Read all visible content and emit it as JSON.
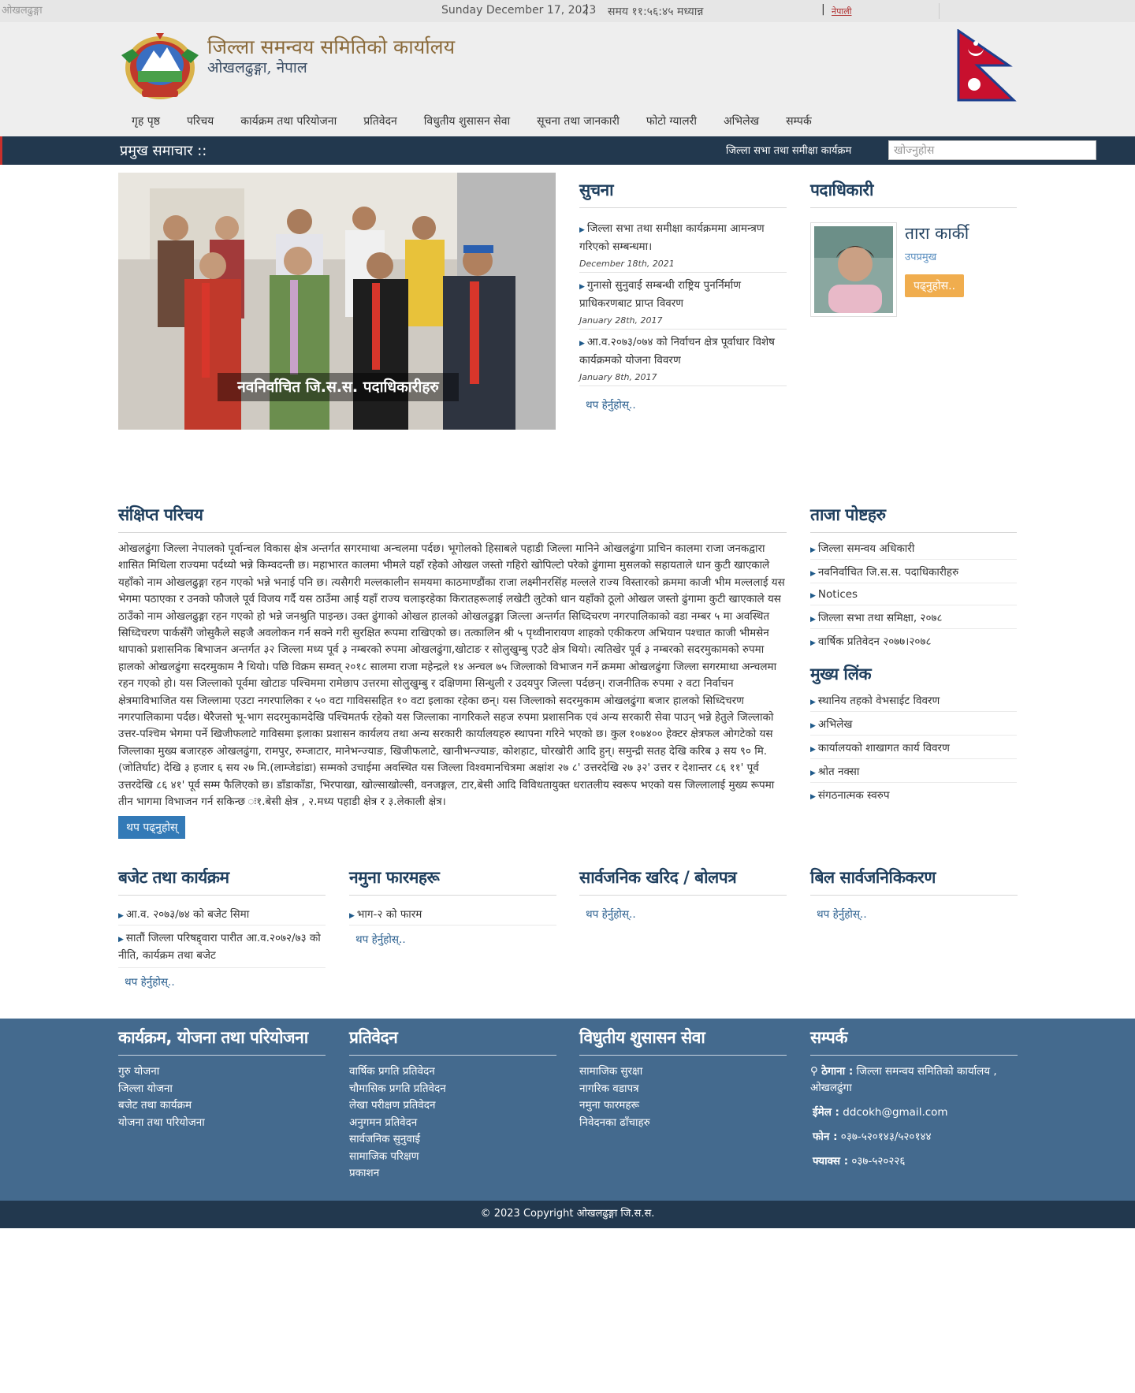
{
  "topbar": {
    "logo_alt": "ओखलढुङ्गा",
    "date": "Sunday December 17, 2023",
    "time": "समय ११:५६:४५ मध्यान्न",
    "language": "नेपाली"
  },
  "header": {
    "title": "जिल्ला समन्वय समितिको कार्यालय",
    "subtitle": "ओखलढुङ्गा, नेपाल"
  },
  "nav": [
    {
      "label": "गृह पृष्ठ"
    },
    {
      "label": "परिचय"
    },
    {
      "label": "कार्यक्रम तथा परियोजना"
    },
    {
      "label": "प्रतिवेदन"
    },
    {
      "label": "विधुतीय शुसासन सेवा"
    },
    {
      "label": "सूचना तथा जानकारी"
    },
    {
      "label": "फोटो ग्यालरी"
    },
    {
      "label": "अभिलेख"
    },
    {
      "label": "सम्पर्क"
    }
  ],
  "newsbar": {
    "label": "प्रमुख समाचार ::",
    "ticker": "जिल्ला सभा तथा समीक्षा कार्यक्रम",
    "search_placeholder": "खोज्नुहोस"
  },
  "slider": {
    "caption": "नवनिर्वाचित जि.स.स. पदाधिकारीहरु"
  },
  "notice": {
    "heading": "सुचना",
    "items": [
      {
        "title": "जिल्ला सभा तथा समीक्षा कार्यक्रममा आमन्त्रण गरिएको सम्बन्धमा।",
        "date": "December 18th, 2021"
      },
      {
        "title": "गुनासो सुनुवाई सम्बन्धी राष्ट्रिय पुनर्निर्माण प्राधिकरणबाट प्राप्त विवरण",
        "date": "January 28th, 2017"
      },
      {
        "title": "आ.व.२०७३/०७४ को निर्वाचन क्षेत्र पूर्वाधार विशेष कार्यक्रमको योजना विवरण",
        "date": "January 8th, 2017"
      }
    ],
    "more": "थप हेर्नुहोस्.."
  },
  "officials": {
    "heading": "पदाधिकारी",
    "name": "तारा कार्की",
    "role": "उपप्रमुख",
    "button": "पढ्नुहोस.."
  },
  "intro": {
    "heading": "संक्षिप्त परिचय",
    "text": "ओखलढुंगा जिल्ला नेपालको पूर्वान्चल विकास क्षेत्र अन्तर्गत सगरमाथा अन्चलमा पर्दछ। भूगोलको हिसाबले पहाडी जिल्ला मानिने ओखलढुंगा प्राचिन कालमा राजा जनकद्वारा शासित मिथिला राज्यमा पर्दथ्यो भन्ने किम्वदन्ती छ। महाभारत कालमा भीमले यहाँ रहेको ओखल जस्तो गहिरो खोपिल्टो परेको ढुंगामा मुसलको सहायताले धान कुटी खाएकाले यहाँको नाम ओखलढुङ्गा रहन गएको भन्ने भनाई पनि छ। त्यसैगरी मल्लकालीन समयमा काठमाण्डौंका राजा लक्ष्मीनरसिंह मल्लले राज्य विस्तारको क्रममा काजी भीम मल्ललाई यस भेगमा पठाएका र उनको फौजले पूर्व विजय गर्दै यस ठाउँमा आई यहाँ राज्य चलाइरहेका किरातहरूलाई लखेटी लुटेको धान यहाँको ठूलो ओखल जस्तो ढुंगामा कुटी खाएकाले यस ठाउँको नाम ओखलढुङ्गा रहन गएको हो भन्ने जनश्रुति पाइन्छ। उक्त ढुंगाको ओखल हालको ओखलढुङ्गा जिल्ला अन्तर्गत सिध्दिचरण नगरपालिकाको वडा नम्बर ५ मा अवस्थित सिध्दिचरण पार्कसँगै जोसुकैले सहजै अवलोकन गर्न सक्ने गरी सुरक्षित रूपमा राखिएको छ। तत्कालिन श्री ५ पृथ्वीनारायण शाहको एकीकरण अभियान पश्चात काजी भीमसेन थापाको प्रशासनिक बिभाजन अन्तर्गत ३२ जिल्ला मध्य पूर्व ३ नम्बरको रुपमा ओखलढुंगा,खोटाङ र सोलुखुम्बु एउटै क्षेत्र थियो। त्यतिखेर पूर्व ३ नम्बरको सदरमुकामको रुपमा हालको ओखलढुंगा सदरमुकाम नै थियो। पछि विक्रम सम्वत् २०१८ सालमा राजा महेन्द्रले १४ अन्चल ७५ जिल्लाको विभाजन गर्ने क्रममा ओखलढुंगा जिल्ला सगरमाथा अन्चलमा रहन गएको हो। यस जिल्लाको पूर्वमा खोटाङ पश्चिममा रामेछाप उत्तरमा सोलुखुम्बु र दक्षिणमा सिन्धुली र उदयपुर जिल्ला पर्दछन्। राजनीतिक रुपमा २ वटा निर्वाचन क्षेत्रमाविभाजित यस जिल्लामा एउटा नगरपालिका र ५० वटा गाविससहित १० वटा इलाका रहेका छन्। यस जिल्लाको सदरमुकाम ओखलढुंगा बजार हालको सिध्दिचरण नगरपालिकामा पर्दछ। थेरैजसो भू-भाग सदरमुकामदेखि पश्चिमतर्फ रहेको यस जिल्लाका नागरिकले सहज रुपमा प्रशासनिक एवं अन्य सरकारी सेवा पाउन् भन्ने हेतुले जिल्लाको उत्तर-पश्चिम भेगमा पर्ने खिजीफलाटे गाविसमा इलाका प्रशासन कार्यलय तथा अन्य सरकारी कार्यालयहरु स्थापना गरिने भएको छ। कुल १०७४०० हेक्टर क्षेत्रफल ओगटेको यस जिल्लाका मुख्य बजारहरु ओखलढुंगा, रामपुर, रुम्जाटार, मानेभन्ज्याङ, खिजीफलाटे, खानीभन्ज्याङ, कोशहाट, घोरखोरी आदि हुन्। समुन्द्री सतह देखि करिब ३ सय ९० मि.(जोतिर्घाट) देखि ३ हजार ६ सय २७ मि.(लाम्जेडांडा) सम्मको उचाईमा अवस्थित यस जिल्ला विश्वमानचित्रमा अक्षांश २७ ८' उत्तरदेखि २७ ३२' उत्तर र देशान्तर ८६ ११' पूर्व उत्तरदेखि ८६ ४१' पूर्व सम्म फैलिएको छ। डाँडाकाँडा, भिरपाखा, खोल्साखोल्सी, वनजङ्गल, टार,बेसी आदि विविधतायुक्त धरातलीय स्वरूप भएको यस जिल्लालाई मुख्य रूपमा तीन भागमा विभाजन गर्न सकिन्छ ः१.बेसी क्षेत्र , २.मध्य पहाडी क्षेत्र र ३.लेकाली क्षेत्र।",
    "readmore": "थप पढ्नुहोस्"
  },
  "latest": {
    "heading": "ताजा पोष्टहरु",
    "items": [
      {
        "label": "जिल्ला समन्वय अधिकारी"
      },
      {
        "label": "नवनिर्वाचित जि.स.स. पदाधिकारीहरु"
      },
      {
        "label": "Notices"
      },
      {
        "label": "जिल्ला सभा तथा समिक्षा, २०७८"
      },
      {
        "label": "वार्षिक प्रतिवेदन २०७७।२०७८"
      }
    ]
  },
  "mainlinks": {
    "heading": "मुख्य लिंक",
    "items": [
      {
        "label": "स्थानिय तहको वेभसाईट विवरण"
      },
      {
        "label": "अभिलेख"
      },
      {
        "label": "कार्यालयको शाखागत कार्य विवरण"
      },
      {
        "label": "श्रोत नक्सा"
      },
      {
        "label": "संगठनात्मक स्वरुप"
      }
    ]
  },
  "budget": {
    "heading": "बजेट तथा कार्यक्रम",
    "items": [
      {
        "label": "आ.व. २०७३/७४ को बजेट सिमा"
      },
      {
        "label": "सातौं जिल्ला परिषद्द्वारा पारीत आ.व.२०७२/७३ को नीति, कार्यक्रम तथा बजेट"
      }
    ],
    "more": "थप हेर्नुहोस्.."
  },
  "forms": {
    "heading": "नमुना फारमहरू",
    "items": [
      {
        "label": "भाग-२ को फारम"
      }
    ],
    "more": "थप हेर्नुहोस्.."
  },
  "procurement": {
    "heading": "सार्वजनिक खरिद / बोलपत्र",
    "more": "थप हेर्नुहोस्.."
  },
  "bills": {
    "heading": "बिल सार्वजनिकिकरण",
    "more": "थप हेर्नुहोस्.."
  },
  "footer": {
    "col1": {
      "heading": "कार्यक्रम, योजना तथा परियोजना",
      "items": [
        "गुरु योजना",
        "जिल्ला योजना",
        "बजेट तथा कार्यक्रम",
        "योजना तथा परियोजना"
      ]
    },
    "col2": {
      "heading": "प्रतिवेदन",
      "items": [
        "वार्षिक प्रगति प्रतिवेदन",
        "चौमासिक प्रगति प्रतिवेदन",
        "लेखा परीक्षण प्रतिवेदन",
        "अनुगमन प्रतिवेदन",
        "सार्वजनिक सुनुवाई",
        "सामाजिक परिक्षण",
        "प्रकाशन"
      ]
    },
    "col3": {
      "heading": "विधुतीय शुसासन सेवा",
      "items": [
        "सामाजिक सुरक्षा",
        "नागरिक वडापत्र",
        "नमुना फारमहरू",
        "निवेदनका ढाँचाहरु"
      ]
    },
    "col4": {
      "heading": "सम्पर्क",
      "address_label": "ठेगाना :",
      "address": "जिल्ला समन्वय समितिको कार्यालय , ओखलढुंगा",
      "email_label": "ईमेल :",
      "email": "ddcokh@gmail.com",
      "phone_label": "फोन :",
      "phone": "०३७-५२०१४३/५२०१४४",
      "fax_label": "फ्याक्स :",
      "fax": "०३७-५२०२२६"
    }
  },
  "copyright": "© 2023 Copyright ओखलढुङ्गा जि.स.स."
}
